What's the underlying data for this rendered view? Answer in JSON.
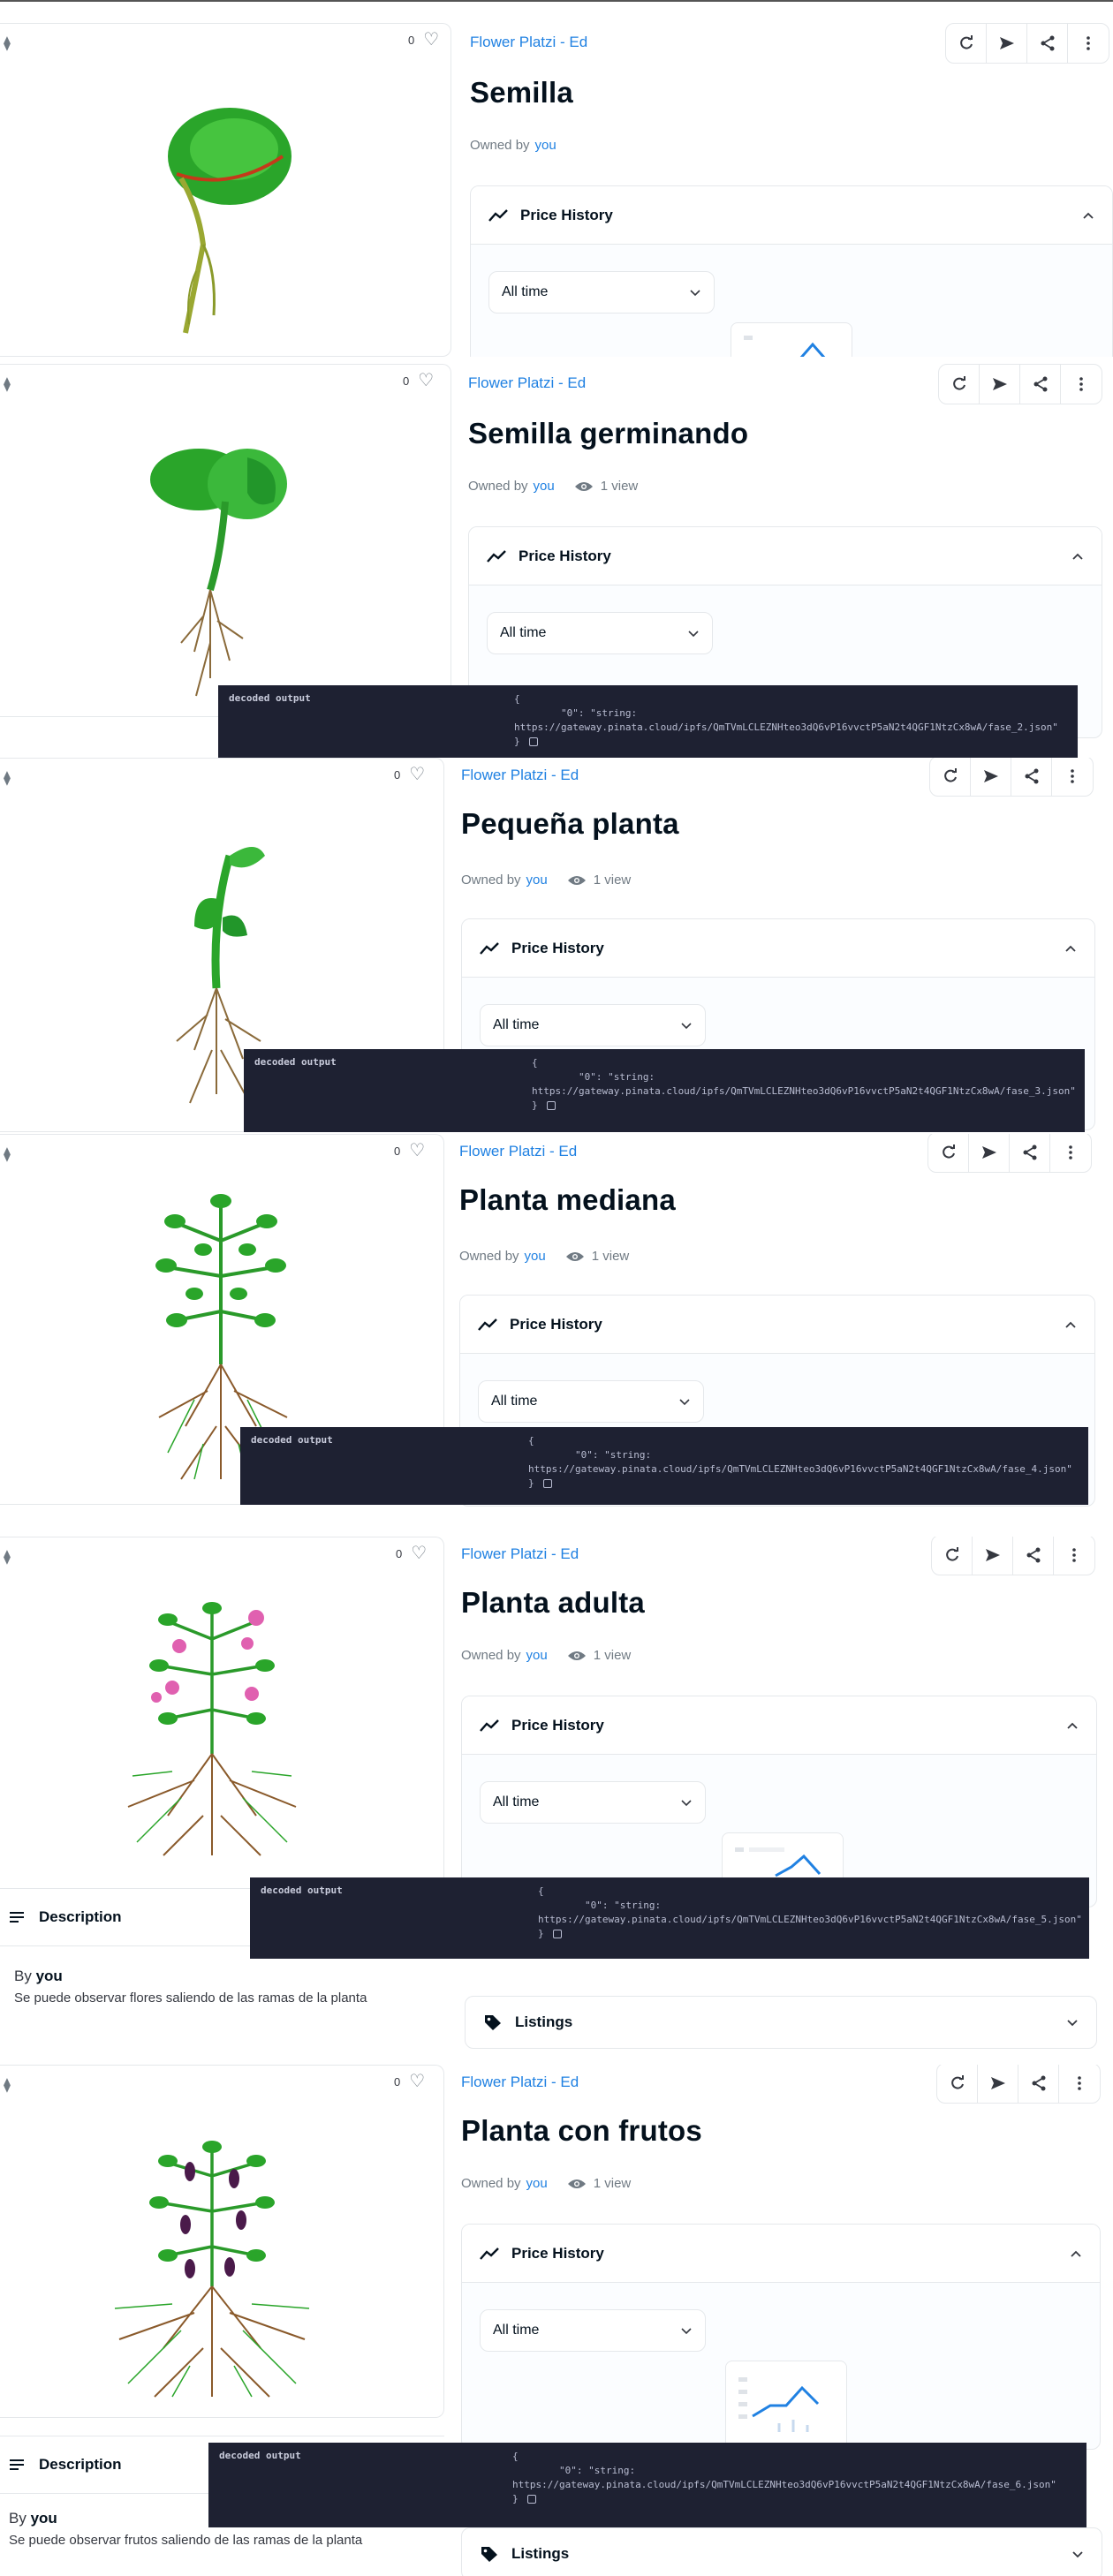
{
  "common": {
    "collection": "Flower Platzi - Ed",
    "owned_by": "Owned by",
    "you": "you",
    "price_history": "Price History",
    "all_time": "All time",
    "decoded_output": "decoded output",
    "like_count": "0",
    "description": "Description",
    "by": "By",
    "listings": "Listings"
  },
  "items": [
    {
      "title": "Semilla",
      "views": "",
      "code_l1": "",
      "code_l2": ""
    },
    {
      "title": "Semilla germinando",
      "views": "1 view",
      "code_l1": "\"0\": \"string:",
      "code_l2": "https://gateway.pinata.cloud/ipfs/QmTVmLCLEZNHteo3dQ6vP16vvctP5aN2t4QGF1NtzCx8wA/fase_2.json\""
    },
    {
      "title": "Pequeña planta",
      "views": "1 view",
      "code_l1": "\"0\": \"string:",
      "code_l2": "https://gateway.pinata.cloud/ipfs/QmTVmLCLEZNHteo3dQ6vP16vvctP5aN2t4QGF1NtzCx8wA/fase_3.json\""
    },
    {
      "title": "Planta mediana",
      "views": "1 view",
      "code_l1": "\"0\": \"string:",
      "code_l2": "https://gateway.pinata.cloud/ipfs/QmTVmLCLEZNHteo3dQ6vP16vvctP5aN2t4QGF1NtzCx8wA/fase_4.json\""
    },
    {
      "title": "Planta adulta",
      "views": "1 view",
      "code_l1": "\"0\": \"string:",
      "code_l2": "https://gateway.pinata.cloud/ipfs/QmTVmLCLEZNHteo3dQ6vP16vvctP5aN2t4QGF1NtzCx8wA/fase_5.json\"",
      "desc_text": "Se puede observar flores saliendo de las ramas de la planta"
    },
    {
      "title": "Planta con frutos",
      "views": "1 view",
      "code_l1": "\"0\": \"string:",
      "code_l2": "https://gateway.pinata.cloud/ipfs/QmTVmLCLEZNHteo3dQ6vP16vvctP5aN2t4QGF1NtzCx8wA/fase_6.json\"",
      "desc_text": "Se puede observar frutos saliendo de las ramas de la planta"
    }
  ],
  "colors": {
    "accent": "#2081e2",
    "text": "#04111d",
    "muted": "#707a83",
    "code_bg": "#1e2132",
    "leaf": "#2aa52a",
    "root": "#8a5a2b",
    "flower": "#e060b0",
    "fruit": "#4a1a4a"
  },
  "icons": [
    "refresh-icon",
    "send-icon",
    "share-icon",
    "more-icon",
    "heart-icon",
    "eye-icon",
    "trend-icon",
    "chevron-up-icon",
    "chevron-down-icon",
    "tag-icon",
    "description-icon",
    "copy-icon",
    "eth-icon"
  ]
}
